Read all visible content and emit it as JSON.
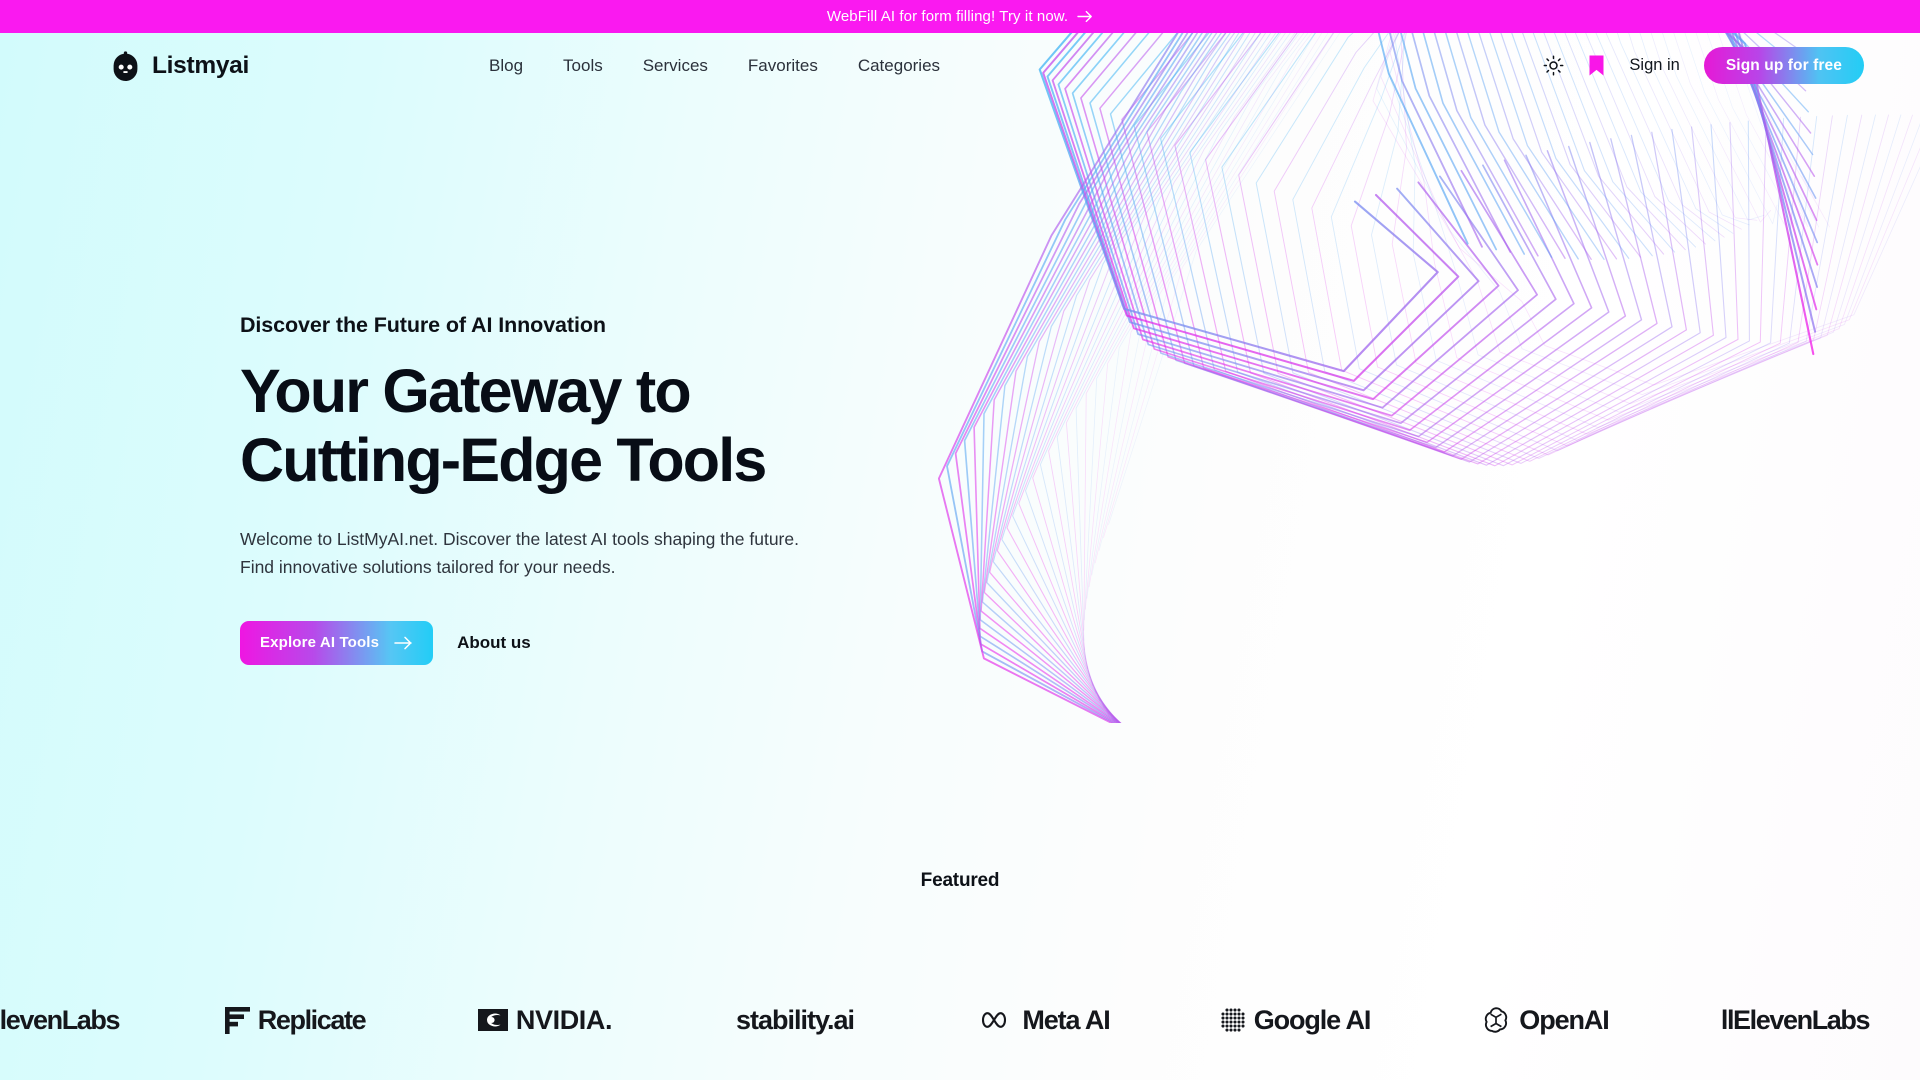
{
  "announcement": {
    "text": "WebFill AI for form filling! Try it now.",
    "icon": "arrow-right-icon",
    "background": "#fa19f0",
    "text_color": "#ffffff"
  },
  "header": {
    "brand": {
      "name": "Listmyai",
      "icon": "robot-head-icon"
    },
    "nav": [
      {
        "label": "Blog"
      },
      {
        "label": "Tools"
      },
      {
        "label": "Services"
      },
      {
        "label": "Favorites"
      },
      {
        "label": "Categories"
      }
    ],
    "theme_toggle_icon": "sun-icon",
    "bookmark_icon": "bookmark-icon",
    "bookmark_color": "#f916e8",
    "sign_in_label": "Sign in",
    "sign_up_label": "Sign up for free"
  },
  "hero": {
    "eyebrow": "Discover the Future of AI Innovation",
    "title_line1": "Your Gateway to",
    "title_line2": "Cutting-Edge Tools",
    "subtitle_line1": "Welcome to ListMyAI.net. Discover the latest AI tools shaping the future.",
    "subtitle_line2": "Find innovative solutions tailored for your needs.",
    "primary_cta": "Explore AI Tools",
    "primary_cta_icon": "arrow-right-icon",
    "secondary_cta": "About us"
  },
  "featured": {
    "label": "Featured",
    "logos": [
      {
        "name": "ElevenLabs",
        "label": "llElevenLabs",
        "icon": "elevenlabs-logo"
      },
      {
        "name": "Replicate",
        "label": "Replicate",
        "icon": "replicate-logo"
      },
      {
        "name": "NVIDIA",
        "label": "NVIDIA.",
        "icon": "nvidia-logo"
      },
      {
        "name": "Stability AI",
        "label": "stability.ai",
        "icon": "stabilityai-logo"
      },
      {
        "name": "Meta AI",
        "label": "Meta AI",
        "icon": "meta-logo"
      },
      {
        "name": "Google AI",
        "label": "Google AI",
        "icon": "google-ai-logo"
      },
      {
        "name": "OpenAI",
        "label": "OpenAI",
        "icon": "openai-logo"
      },
      {
        "name": "ElevenLabs",
        "label": "llElevenLabs",
        "icon": "elevenlabs-logo"
      },
      {
        "name": "Replicate",
        "label": "Replicate",
        "icon": "replicate-logo"
      }
    ]
  },
  "theme": {
    "accent_magenta": "#fa19f0",
    "accent_cyan": "#22cdf6",
    "page_background_left": "#d2fbfc",
    "page_background_right": "#ffffff",
    "text_primary": "#0d1117"
  }
}
